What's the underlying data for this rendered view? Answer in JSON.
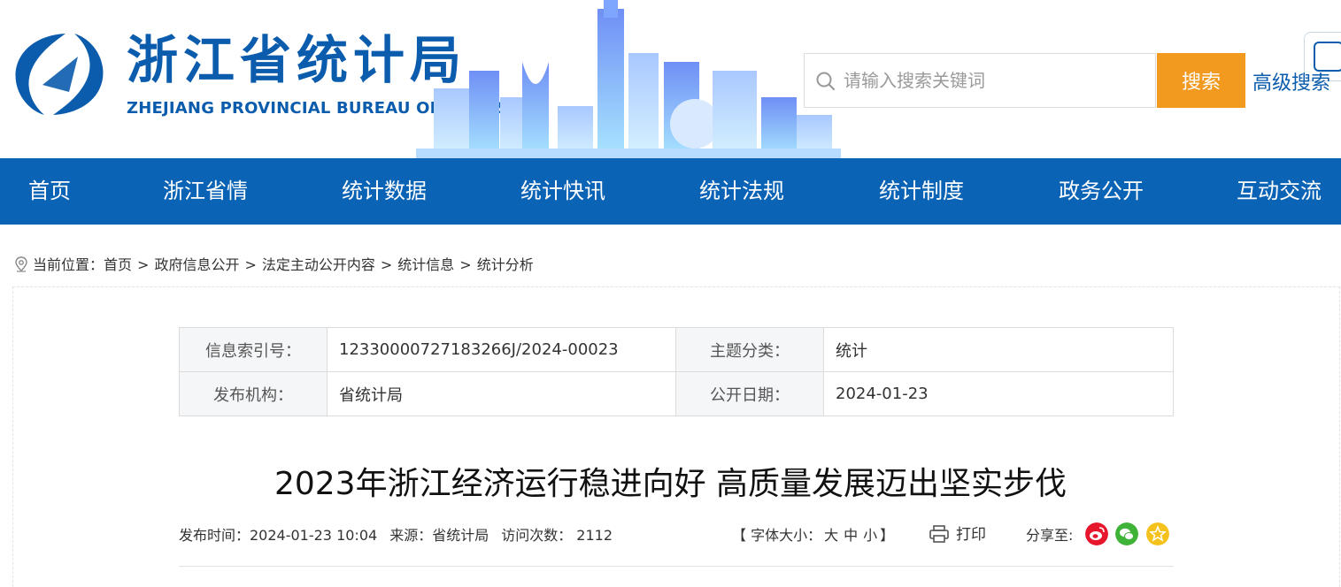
{
  "header": {
    "site_title": "浙江省统计局",
    "site_subtitle": "ZHEJIANG PROVINCIAL BUREAU OF STATISTICS",
    "brand_color": "#0b5cad"
  },
  "search": {
    "placeholder": "请输入搜索关键词",
    "button_label": "搜索",
    "advanced_label": "高级搜索",
    "button_color": "#f29a1f"
  },
  "nav": {
    "background": "#0b63b5",
    "items": [
      {
        "label": "首页"
      },
      {
        "label": "浙江省情"
      },
      {
        "label": "统计数据"
      },
      {
        "label": "统计快讯"
      },
      {
        "label": "统计法规"
      },
      {
        "label": "统计制度"
      },
      {
        "label": "政务公开"
      },
      {
        "label": "互动交流"
      }
    ]
  },
  "breadcrumb": {
    "prefix": "当前位置：",
    "items": [
      "首页",
      "政府信息公开",
      "法定主动公开内容",
      "统计信息",
      "统计分析"
    ],
    "separator": ">"
  },
  "meta_table": {
    "index_label": "信息索引号：",
    "index_value": "12330000727183266J/2024-00023",
    "topic_label": "主题分类：",
    "topic_value": "统计",
    "publisher_label": "发布机构：",
    "publisher_value": "省统计局",
    "date_label": "公开日期：",
    "date_value": "2024-01-23"
  },
  "article": {
    "title": "2023年浙江经济运行稳进向好 高质量发展迈出坚实步伐",
    "publish_time": "发布时间：2024-01-23 10:04",
    "source": "来源：省统计局",
    "visits": "访问次数： 2112"
  },
  "tools": {
    "font_size_open": "【 字体大小：",
    "font_large": "大",
    "font_medium": "中",
    "font_small": "小",
    "font_size_close": "】",
    "print_label": "打印",
    "share_label": "分享至:"
  },
  "share_icons": [
    {
      "icon": "weibo-icon",
      "color": "#e6162d"
    },
    {
      "icon": "wechat-icon",
      "color": "#3fb337"
    },
    {
      "icon": "qzone-icon",
      "color": "#f5c11d"
    }
  ]
}
